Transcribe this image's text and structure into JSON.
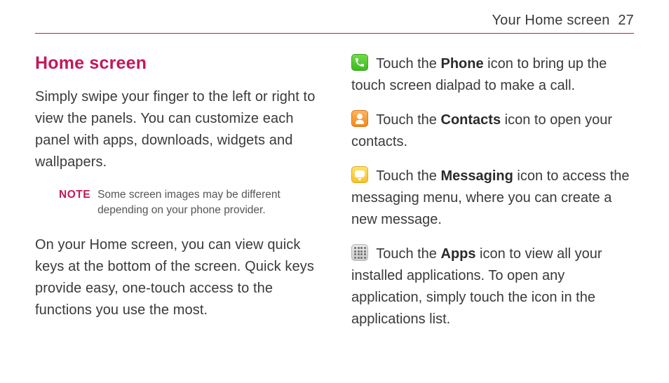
{
  "header": {
    "section": "Your Home screen",
    "page": "27"
  },
  "left": {
    "title": "Home screen",
    "intro": "Simply swipe your finger to the left or right to view the panels. You can customize each panel with apps, downloads, widgets and wallpapers.",
    "note_label": "NOTE",
    "note_text": "Some screen images may be different depending on your phone provider.",
    "quickkeys": "On your Home screen, you can view quick keys at the bottom of the screen. Quick keys provide easy, one-touch access to the functions you use the most."
  },
  "right": {
    "items": [
      {
        "icon": "phone-icon",
        "lead": "Touch the ",
        "bold": "Phone",
        "tail": " icon to bring up the touch screen dialpad to make a call."
      },
      {
        "icon": "contacts-icon",
        "lead": "Touch the ",
        "bold": "Contacts",
        "tail": " icon to open your contacts."
      },
      {
        "icon": "messaging-icon",
        "lead": "Touch the ",
        "bold": "Messaging",
        "tail": " icon to access the messaging menu, where you can create a new message."
      },
      {
        "icon": "apps-icon",
        "lead": "Touch the ",
        "bold": "Apps",
        "tail": " icon to view all your installed applications. To open any application, simply touch the icon in the applications list."
      }
    ]
  }
}
